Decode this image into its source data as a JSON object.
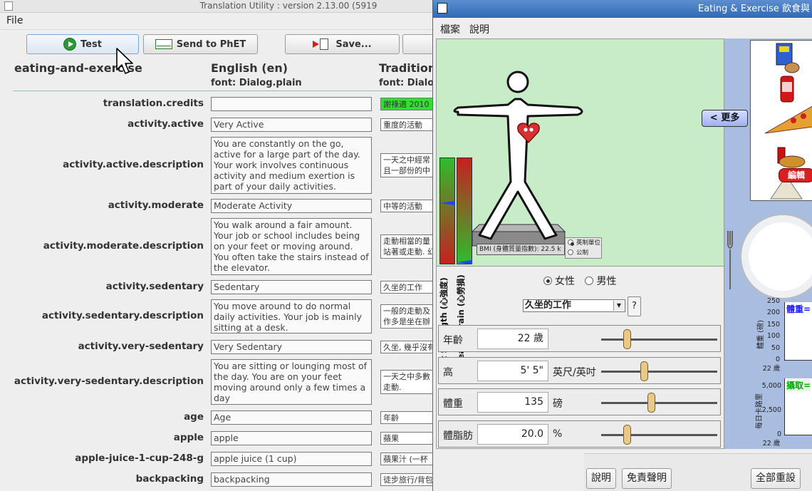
{
  "translation_utility": {
    "title": "Translation Utility : version 2.13.00 (5919",
    "menu": {
      "file": "File"
    },
    "toolbar": {
      "test": "Test",
      "send": "Send to PhET",
      "save": "Save..."
    },
    "header": {
      "sim": "eating-and-exercise",
      "english": "English (en)",
      "english_font": "font: Dialog.plain",
      "target": "Tradition",
      "target_font": "font: Dialo"
    },
    "rows": [
      {
        "key": "translation.credits",
        "en": "",
        "tr": "謝祿適 2010",
        "green": true
      },
      {
        "key": "activity.active",
        "en": "Very Active",
        "tr": "重度的活動"
      },
      {
        "key": "activity.active.description",
        "en": "You are constantly on the go, active for a large part of the day. Your work involves continuous activity and medium exertion is part of your daily activities.",
        "tr": "一天之中經常\n且一部份的中"
      },
      {
        "key": "activity.moderate",
        "en": "Moderate Activity",
        "tr": "中等的活動"
      },
      {
        "key": "activity.moderate.description",
        "en": "You walk around a fair amount. Your job or school includes being on your feet or moving around. You often take the stairs instead of the elevator.",
        "tr": "走動相當的量\n站著或走動. 幻"
      },
      {
        "key": "activity.sedentary",
        "en": "Sedentary",
        "tr": "久坐的工作"
      },
      {
        "key": "activity.sedentary.description",
        "en": "You move around to do normal daily activities.  Your job is mainly sitting at a desk.",
        "tr": "一般的走動及\n作多是坐在辦"
      },
      {
        "key": "activity.very-sedentary",
        "en": "Very Sedentary",
        "tr": "久坐, 幾乎沒有"
      },
      {
        "key": "activity.very-sedentary.description",
        "en": "You are sitting or lounging most of the day. You are on your feet moving around only a few times a day",
        "tr": "一天之中多數\n走動."
      },
      {
        "key": "age",
        "en": "Age",
        "tr": "年齡"
      },
      {
        "key": "apple",
        "en": "apple",
        "tr": "蘋果"
      },
      {
        "key": "apple-juice-1-cup-248-g",
        "en": "apple juice (1 cup)",
        "tr": "蘋果汁 (一杯"
      },
      {
        "key": "backpacking",
        "en": "backpacking",
        "tr": "徒步旅行/背包"
      }
    ]
  },
  "eating_exercise": {
    "title": "Eating & Exercise 飲食與",
    "menu": {
      "file": "檔案",
      "help": "說明"
    },
    "heart_strength": "Heart Strength (心強度)",
    "heart_strain": "Heart Strain (心勞損)",
    "bmi": "BMI (身體質量指數): 22.5 k",
    "units": {
      "english": "英制單位",
      "metric": "公制"
    },
    "gender": {
      "female": "女性",
      "male": "男性",
      "selected": "female"
    },
    "activity": {
      "selected": "久坐的工作",
      "help": "?"
    },
    "params": [
      {
        "label": "年齡",
        "value": "22 歲",
        "unit": "",
        "slider": 0.22
      },
      {
        "label": "高",
        "value": "5' 5\"",
        "unit": "英尺/英吋",
        "slider": 0.37
      },
      {
        "label": "體重",
        "value": "135",
        "unit": "磅",
        "slider": 0.43
      },
      {
        "label": "體脂肪",
        "value": "20.0",
        "unit": "%",
        "slider": 0.22
      }
    ],
    "more": "< 更多",
    "edit": "編輯",
    "weight_graph": {
      "title": "體重=",
      "ylabel": "體重 (磅)",
      "ticks": [
        "250",
        "200",
        "150",
        "100",
        "50",
        "0"
      ],
      "x": "22 歲"
    },
    "calorie_graph": {
      "title": "攝取=",
      "ylabel": "每日卡路里",
      "ticks": [
        "5,000",
        "2,500",
        "0"
      ],
      "x": "22 歲"
    },
    "bottom": {
      "help": "說明",
      "disclaimer": "免責聲明",
      "reset": "全部重設"
    }
  }
}
